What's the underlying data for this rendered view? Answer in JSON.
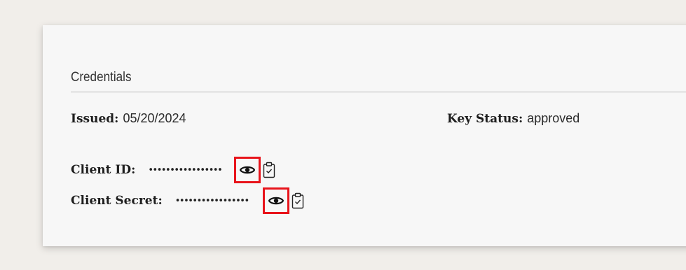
{
  "credentials": {
    "title": "Credentials",
    "issued_label": "Issued:",
    "issued_value": "05/20/2024",
    "key_status_label": "Key Status:",
    "key_status_value": "approved",
    "client_id_label": "Client ID:",
    "client_id_masked": "•••••••••••••••••",
    "client_secret_label": "Client Secret:",
    "client_secret_masked": "•••••••••••••••••"
  },
  "icons": {
    "reveal": "eye-icon",
    "copy": "clipboard-check-icon"
  },
  "colors": {
    "highlight_border": "#e8141b",
    "page_background": "#f1eeea",
    "card_background": "#f7f7f7"
  }
}
